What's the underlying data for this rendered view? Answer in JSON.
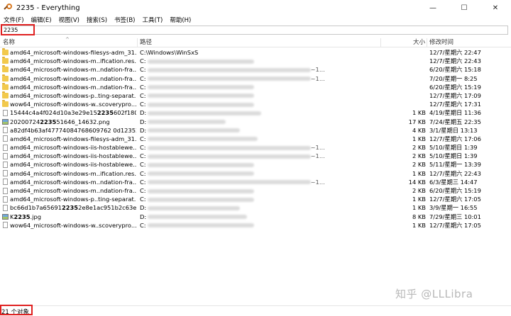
{
  "window": {
    "title": "2235 - Everything",
    "app_icon": "everything-magnifier-icon",
    "minimize_glyph": "—",
    "maximize_glyph": "☐",
    "close_glyph": "✕"
  },
  "menu": [
    "文件(F)",
    "编辑(E)",
    "视图(V)",
    "搜索(S)",
    "书签(B)",
    "工具(T)",
    "帮助(H)"
  ],
  "search": {
    "value": "2235"
  },
  "columns": {
    "name": "名称",
    "path": "路径",
    "size": "大小",
    "date": "修改时间"
  },
  "highlight_color": "#e02020",
  "rows": [
    {
      "icon": "folder",
      "name": "amd64_microsoft-windows-filesys-adm_31...",
      "path": "C:\\Windows\\WinSxS",
      "size": "",
      "date": "12/7/星期六 22:47"
    },
    {
      "icon": "folder",
      "name": "amd64_microsoft-windows-m..ification.res...",
      "path": "C:",
      "size": "",
      "date": "12/7/星期六 22:43"
    },
    {
      "icon": "folder",
      "name": "amd64_microsoft-windows-m..ndation-fra...",
      "path": "C:",
      "path_tail": "~1...",
      "size": "",
      "date": "6/20/星期六 15:18"
    },
    {
      "icon": "folder",
      "name": "amd64_microsoft-windows-m..ndation-fra...",
      "path": "C:",
      "path_tail": "~1...",
      "size": "",
      "date": "7/20/星期一 8:25"
    },
    {
      "icon": "folder",
      "name": "amd64_microsoft-windows-m..ndation-fra...",
      "path": "C:",
      "size": "",
      "date": "6/20/星期六 15:19"
    },
    {
      "icon": "folder",
      "name": "amd64_microsoft-windows-p..ting-separat...",
      "path": "C:",
      "size": "",
      "date": "12/7/星期六 17:09"
    },
    {
      "icon": "folder",
      "name": "wow64_microsoft-windows-w..scoverypro...",
      "path": "C:",
      "size": "",
      "date": "12/7/星期六 17:31"
    },
    {
      "icon": "file",
      "name": "15444c4a4f024d10a3e29e15",
      "name_bold": "2235",
      "name_after": "602f180...",
      "path": "D:",
      "size": "1 KB",
      "date": "4/19/星期日 11:36"
    },
    {
      "icon": "image",
      "name": "20200724",
      "name_bold": "2235",
      "name_after": "51646_14632.png",
      "path": "D:",
      "size": "17 KB",
      "date": "7/24/星期五 22:35"
    },
    {
      "icon": "file",
      "name": "a82df4b63af47774084768609762 0d12352...",
      "path": "D:",
      "size": "4 KB",
      "date": "3/1/星期日 13:13"
    },
    {
      "icon": "file",
      "name": "amd64_microsoft-windows-filesys-adm_31...",
      "path": "C:",
      "size": "1 KB",
      "date": "12/7/星期六 17:06"
    },
    {
      "icon": "file",
      "name": "amd64_microsoft-windows-iis-hostablewe...",
      "path": "C:",
      "path_tail": "~1...",
      "size": "2 KB",
      "date": "5/10/星期日 1:39"
    },
    {
      "icon": "file",
      "name": "amd64_microsoft-windows-iis-hostablewe...",
      "path": "C:",
      "path_tail": "~1...",
      "size": "2 KB",
      "date": "5/10/星期日 1:39"
    },
    {
      "icon": "file",
      "name": "amd64_microsoft-windows-iis-hostablewe...",
      "path": "C:",
      "size": "2 KB",
      "date": "5/11/星期一 13:39"
    },
    {
      "icon": "file",
      "name": "amd64_microsoft-windows-m..ification.res...",
      "path": "C:",
      "size": "1 KB",
      "date": "12/7/星期六 22:43"
    },
    {
      "icon": "file",
      "name": "amd64_microsoft-windows-m..ndation-fra...",
      "path": "C:",
      "path_tail": "~1...",
      "size": "14 KB",
      "date": "6/3/星期三 14:47"
    },
    {
      "icon": "file",
      "name": "amd64_microsoft-windows-m..ndation-fra...",
      "path": "C:",
      "size": "2 KB",
      "date": "6/20/星期六 15:19"
    },
    {
      "icon": "file",
      "name": "amd64_microsoft-windows-p..ting-separat...",
      "path": "C:",
      "size": "1 KB",
      "date": "12/7/星期六 17:05"
    },
    {
      "icon": "file",
      "name": "bc66d1b7a65691",
      "name_bold": "2235",
      "name_after": "2e8e1ac951b2c63e...",
      "path": "D:",
      "size": "1 KB",
      "date": "3/9/星期一 16:55"
    },
    {
      "icon": "image",
      "name": "K",
      "name_bold": "2235",
      "name_after": ".jpg",
      "path": "D:",
      "size": "8 KB",
      "date": "7/29/星期三 10:01"
    },
    {
      "icon": "file",
      "name": "wow64_microsoft-windows-w..scoverypro...",
      "path": "C:",
      "size": "1 KB",
      "date": "12/7/星期六 17:05"
    }
  ],
  "status": {
    "count_text": "21 个对象"
  },
  "watermark": "知乎 @LLLibra"
}
